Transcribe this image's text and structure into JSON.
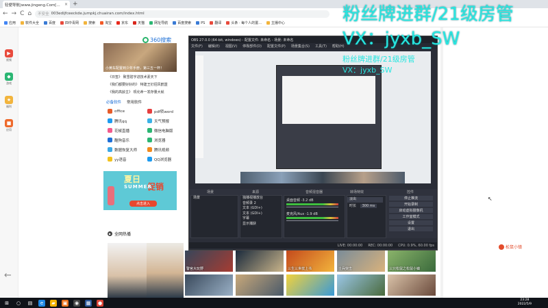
{
  "browser": {
    "tab_title": "轻便导航|www.jingeng.Com[...",
    "tab_close": "×",
    "new_tab": "+",
    "nav_back": "←",
    "nav_forward": "→",
    "nav_reload": "C",
    "nav_home": "⌂",
    "security": "不安全",
    "url": "003edijfceeckde.jumpkj.chuairan.com/index.html",
    "bookmarks": [
      "应用",
      "软件大全",
      "百度",
      "四中青网",
      "搜索",
      "淘宝",
      "京东",
      "天猫",
      "网址导航",
      "百度搜索",
      "PS",
      "翻译",
      "头条 · 每个人的置...",
      "主播中心"
    ]
  },
  "dock": [
    {
      "label": "视频",
      "icon": "▶",
      "color": "#e84a3c"
    },
    {
      "label": "游戏",
      "icon": "◆",
      "color": "#2bb673"
    },
    {
      "label": "福利",
      "icon": "★",
      "color": "#f2b43c"
    },
    {
      "label": "应用",
      "icon": "■",
      "color": "#ee6a2c"
    }
  ],
  "page": {
    "search_logo": "360搜索",
    "banner_caption": "小黄车配置到少年手册，第三五一杯！",
    "news": [
      "《日签》 致雪碧字进技术素天下",
      "《我们都要好好的》 特建王钉招风鹤盟",
      "《我的高龄主》 现化命一发存量大就"
    ],
    "soft_tabs": [
      "必备软件",
      "常用软件"
    ],
    "apps": [
      {
        "name": "office",
        "color": "#e65c2a"
      },
      {
        "name": "pdf转word",
        "color": "#e63f3f"
      },
      {
        "name": "腾讯qq",
        "color": "#1d9bf0"
      },
      {
        "name": "天气预报",
        "color": "#3bb2e6"
      },
      {
        "name": "花椒直播",
        "color": "#f25a8c"
      },
      {
        "name": "微信电脑版",
        "color": "#2bb673"
      },
      {
        "name": "酷狗音乐",
        "color": "#1d6fd6"
      },
      {
        "name": "浏览器",
        "color": "#2bb673"
      },
      {
        "name": "数据恢复大师",
        "color": "#3ba8e6"
      },
      {
        "name": "腾讯视频",
        "color": "#f28b1d"
      },
      {
        "name": "yy语音",
        "color": "#f2c21d"
      },
      {
        "name": "QQ浏览器",
        "color": "#1d9bf0"
      }
    ],
    "summer_title": "夏日",
    "summer_en": "SUMMER",
    "summer_sale": "促销",
    "summer_button": "点击进入",
    "hot_title": "全网热播",
    "thumbs": [
      "警官大玩野",
      "",
      "三生三世枕上书",
      "士兵突击",
      "三只松鼠之松鼠小镇",
      "",
      "",
      "",
      "",
      ""
    ],
    "songshu": "松鼠小镇"
  },
  "watermark": {
    "line1": "粉丝牌进群/21级房管",
    "line2": "VX：jyxb_SW",
    "line3": "粉丝牌进群/21级房管",
    "line4": "VX：jyxb_SW"
  },
  "obs": {
    "title": "OBS 27.0.0 (64-bit, windows) - 配置文件: 未命名 - 场景: 未命名",
    "menu": [
      "文件(F)",
      "编辑(E)",
      "视图(V)",
      "停靠部件(D)",
      "配置文件(P)",
      "场景集合(S)",
      "工具(T)",
      "帮助(H)"
    ],
    "panel_headers": [
      "场景",
      "来源",
      "音频混音器",
      "转场特效",
      "控件"
    ],
    "scene_item": "场景",
    "sources": [
      "独播视播放台",
      "音频录 2",
      "文本 (GDI+)",
      "文本 (GDI+)",
      "字幕",
      "显示捕获"
    ],
    "mixer": [
      {
        "name": "桌面音频",
        "db": "-3.2 dB"
      },
      {
        "name": "麦克风/Aux",
        "db": "-1.9 dB"
      }
    ],
    "transition": "淡出",
    "duration_label": "时长",
    "duration": "300 ms",
    "controls": [
      "停止推流",
      "开始录制",
      "启动虚拟摄像机",
      "工作室模式",
      "设置",
      "退出"
    ],
    "status": [
      "LIVE: 00:00:00",
      "REC: 00:00:00",
      "CPU: 0.9%, 60.00 fps"
    ]
  },
  "taskbar": {
    "time": "23:28",
    "date": "2022/5/9",
    "apps": [
      {
        "icon": "⊞",
        "color": "transparent"
      },
      {
        "icon": "○",
        "color": "transparent"
      },
      {
        "icon": "▤",
        "color": "transparent"
      },
      {
        "icon": "e",
        "color": "#1e88e5"
      },
      {
        "icon": "▰",
        "color": "#f4b400"
      },
      {
        "icon": "▣",
        "color": "#e8711c"
      },
      {
        "icon": "◉",
        "color": "#444"
      },
      {
        "icon": "▦",
        "color": "#2b579a"
      },
      {
        "icon": "●",
        "color": "#db4437"
      }
    ]
  }
}
